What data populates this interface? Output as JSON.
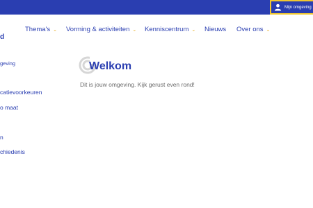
{
  "topbar": {
    "account_label": "Mijn omgeving"
  },
  "logo": {
    "fragment": "d"
  },
  "nav": {
    "items": [
      {
        "label": "Thema's",
        "has_dropdown": true
      },
      {
        "label": "Vorming & activiteiten",
        "has_dropdown": true
      },
      {
        "label": "Kenniscentrum",
        "has_dropdown": true
      },
      {
        "label": "Nieuws",
        "has_dropdown": false
      },
      {
        "label": "Over ons",
        "has_dropdown": true
      }
    ]
  },
  "sidebar": {
    "items": [
      {
        "label": "geving"
      },
      {
        "label": "catievoorkeuren"
      },
      {
        "label": "o maat"
      },
      {
        "label": "n"
      },
      {
        "label": "chiedenis"
      }
    ]
  },
  "main": {
    "title": "Welkom",
    "text": "Dit is jouw omgeving. Kijk gerust even rond!"
  },
  "colors": {
    "brand_blue": "#2a3eb1",
    "accent_yellow": "#f2c82f",
    "chevron_orange": "#e6a817",
    "body_text": "#6b6b6b"
  },
  "icons": {
    "account": "user-icon",
    "dropdown": "chevron-down-icon",
    "brand": "logo-swirl-icon"
  }
}
